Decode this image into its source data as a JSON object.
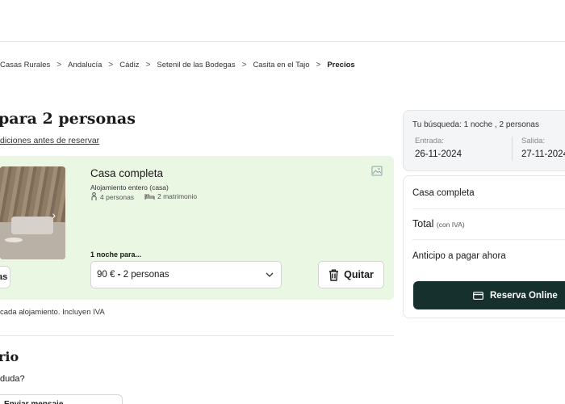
{
  "breadcrumb": {
    "items": [
      "Casas Rurales",
      "Andalucía",
      "Cádiz",
      "Setenil de las Bodegas",
      "Casita en el Tajo",
      "Precios"
    ],
    "separator": ">"
  },
  "heading": "para 2 personas",
  "conditions_link": "diciones antes de reservar",
  "offer": {
    "title": "Casa completa",
    "type": "Alojamiento entero (casa)",
    "persons": "4 personas",
    "beds": "2 matrimonio",
    "gallery_button": "as",
    "nights_label": "1 noche para...",
    "price_value": "90 €",
    "price_people": "2 personas",
    "remove_label": "Quitar"
  },
  "footnote": "cada alojamiento. Incluyen IVA",
  "section_title": "rio",
  "question": "duda?",
  "contact_button": "Enviar mensaje",
  "search": {
    "summary": "Tu búsqueda: 1 noche , 2 personas",
    "checkin_label": "Entrada:",
    "checkin_value": "26-11-2024",
    "checkout_label": "Salida:",
    "checkout_value": "27-11-2024"
  },
  "summary": {
    "item": "Casa completa",
    "total_label": "Total",
    "total_note": "(con IVA)",
    "deposit_label": "Anticipo a pagar ahora",
    "book_button": "Reserva Online"
  },
  "colors": {
    "offer_bg": "#e9f7e3",
    "book_button_bg": "#16302e",
    "search_bg": "#f3f5f7"
  },
  "icons": [
    "chevron-right-icon",
    "person-icon",
    "bed-icon",
    "image-icon",
    "chevron-down-icon",
    "trash-icon",
    "credit-card-icon"
  ]
}
